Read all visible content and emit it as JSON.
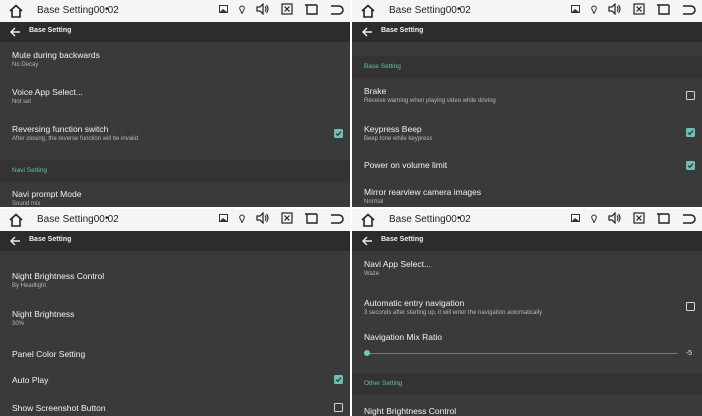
{
  "colors": {
    "accent": "#6bc1b2",
    "panel_bg": "#3a3a3a",
    "statusbar_bg": "#f5f5f5"
  },
  "statusbar": {
    "title": "Base Setting00:02",
    "dot": "•",
    "icons": [
      "home-icon",
      "image-icon",
      "location-icon",
      "volume-icon",
      "close-box-icon",
      "window-icon",
      "back-return-icon"
    ]
  },
  "appbar": {
    "title": "Base Setting"
  },
  "panel1": {
    "mute": {
      "title": "Mute during backwards",
      "sub": "No Decay"
    },
    "voice": {
      "title": "Voice App Select...",
      "sub": "Not set"
    },
    "reversing": {
      "title": "Reversing function switch",
      "sub": "After closing, the reverse function will be invalid",
      "checked": true
    },
    "navi_header": "Navi Setting",
    "navi_prompt": {
      "title": "Navi prompt Mode",
      "sub": "Sound mix"
    }
  },
  "panel2": {
    "header": "Base Setting",
    "brake": {
      "title": "Brake",
      "sub": "Receive warning when playing video while driving",
      "checked": false
    },
    "keypress": {
      "title": "Keypress Beep",
      "sub": "Beep tone while keypress",
      "checked": true
    },
    "power": {
      "title": "Power on volume limit",
      "checked": true
    },
    "mirror": {
      "title": "Mirror rearview camera images",
      "sub": "Normal"
    }
  },
  "panel3": {
    "night_ctrl": {
      "title": "Night Brightness Control",
      "sub": "By Headlight"
    },
    "night_bright": {
      "title": "Night Brightness",
      "sub": "30%"
    },
    "panel_color": {
      "title": "Panel Color Setting"
    },
    "auto_play": {
      "title": "Auto Play",
      "checked": true
    },
    "screenshot": {
      "title": "Show Screenshot Button",
      "checked": false
    }
  },
  "panel4": {
    "navi_app": {
      "title": "Navi App Select...",
      "sub": "Waze"
    },
    "auto_entry": {
      "title": "Automatic entry navigation",
      "sub": "3 seconds after starting up, it will enter the navigation automatically",
      "checked": false
    },
    "mix_ratio": {
      "title": "Navigation Mix Ratio",
      "value": "-5",
      "level": 0.0
    },
    "other_header": "Other Setting",
    "night_ctrl": {
      "title": "Night Brightness Control"
    }
  }
}
